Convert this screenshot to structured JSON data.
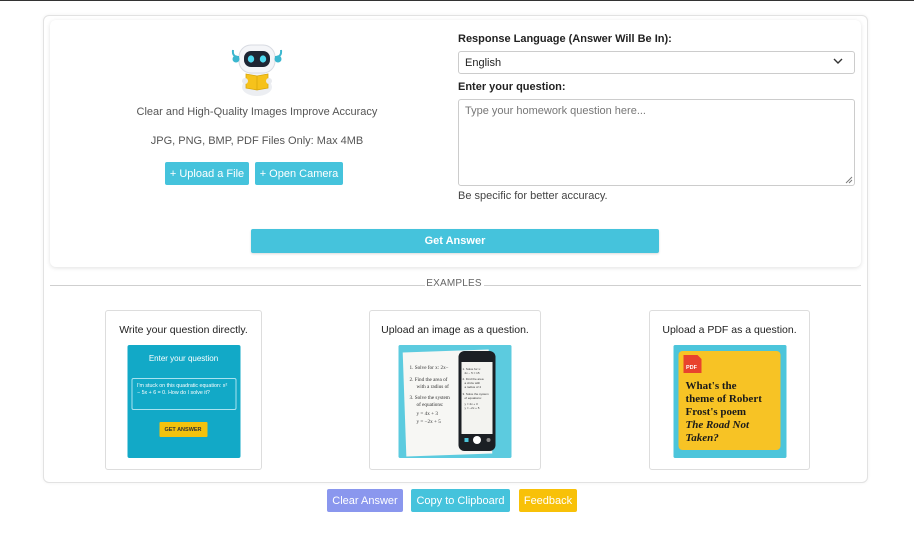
{
  "upload": {
    "hint_quality": "Clear and High-Quality Images Improve Accuracy",
    "hint_formats": "JPG, PNG, BMP, PDF Files Only: Max 4MB",
    "upload_label": "+ Upload a File",
    "camera_label": "+ Open Camera"
  },
  "form": {
    "language_label": "Response Language (Answer Will Be In):",
    "language_value": "English",
    "question_label": "Enter your question:",
    "question_placeholder": "Type your homework question here...",
    "accuracy_hint": "Be specific for better accuracy.",
    "submit_label": "Get Answer"
  },
  "examples": {
    "heading": "EXAMPLES",
    "cards": [
      {
        "title": "Write your question directly.",
        "thumb_heading": "Enter your question",
        "thumb_text": "I'm stuck on this quadratic equation: x² − 5x + 6 = 0. How do I solve it?",
        "thumb_button": "GET ANSWER"
      },
      {
        "title": "Upload an image as a question.",
        "paper_lines": [
          "1. Solve for x:  2x−",
          "2. Find the area of",
          "with a radius of",
          "3. Solve the system",
          "of equations:",
          "y = 4x + 3",
          "y = −2x + 5"
        ],
        "phone_lines": [
          "1. Solve for x:",
          "2x − 5 = 15",
          "2. Find the area",
          "a circle with",
          "a radius of 4",
          "3. Solve the system",
          "of equations:",
          "y = 4x + 3",
          "y = −2x + 5"
        ]
      },
      {
        "title": "Upload a PDF as a question.",
        "pdf_badge": "PDF",
        "pdf_lines": [
          "What's the",
          "theme of Robert",
          "Frost's poem",
          "The Road Not",
          "Taken?"
        ]
      }
    ]
  },
  "actions": {
    "clear_label": "Clear Answer",
    "copy_label": "Copy to Clipboard",
    "feedback_label": "Feedback"
  },
  "colors": {
    "accent": "#45c3dc",
    "clear": "#8a97ee",
    "feedback": "#f8c108",
    "pdf_bg": "#f7c325"
  },
  "icons": [
    "robot-mascot-icon",
    "chevron-down-icon",
    "resize-grip-icon",
    "pdf-file-icon"
  ]
}
